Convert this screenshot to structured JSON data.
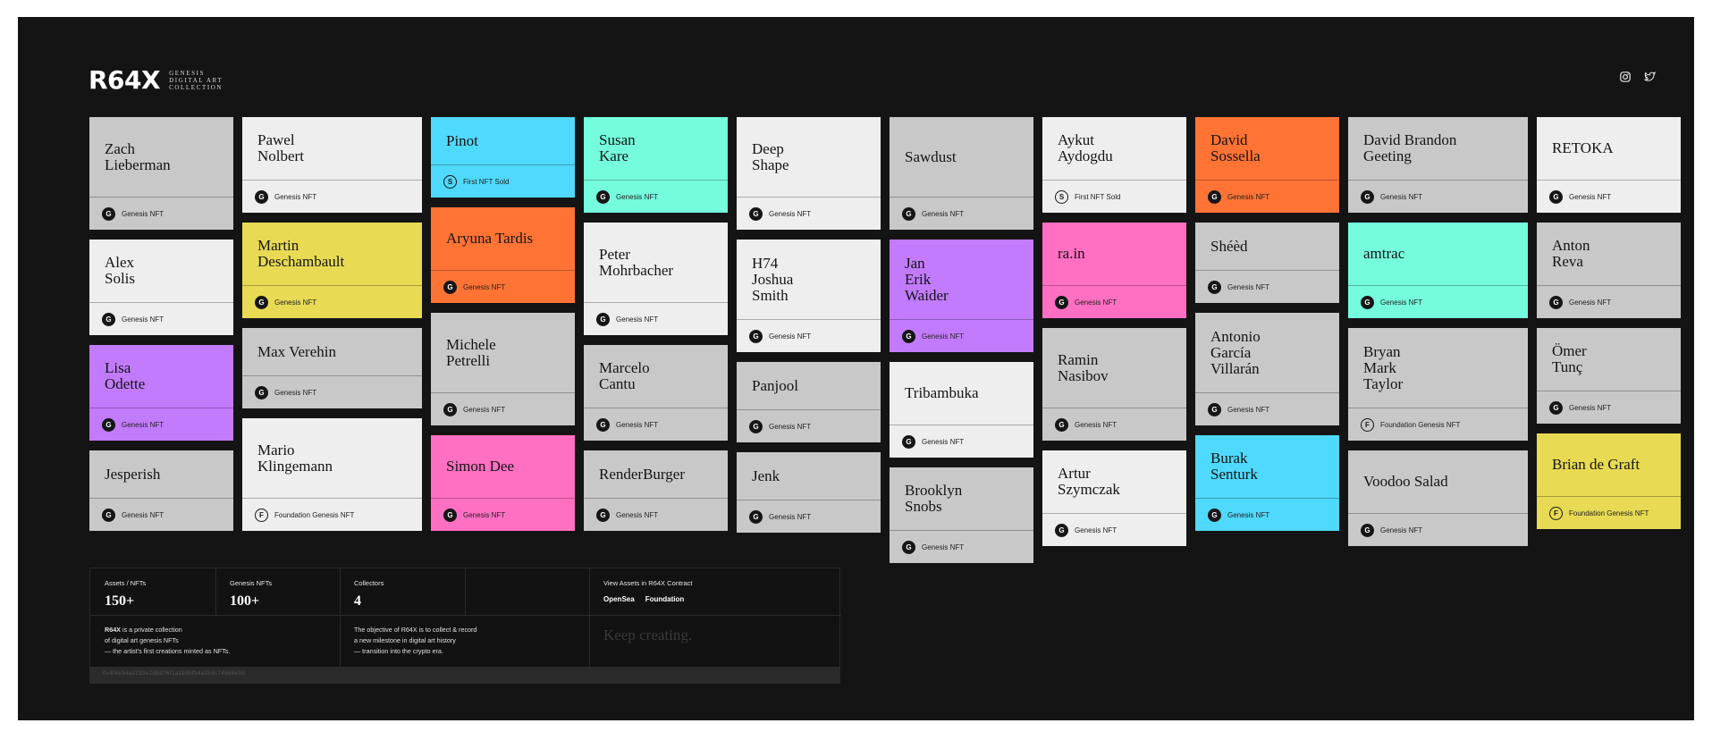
{
  "brand": {
    "mark": "R64X",
    "subtitle": [
      "GENESIS",
      "DIGITAL ART",
      "COLLECTION"
    ]
  },
  "social": {
    "icons": [
      "instagram-icon",
      "twitter-icon"
    ]
  },
  "colors": {
    "bg": "#141414",
    "light": "#eeeeee",
    "gray": "#c8c8c8",
    "cyan": "#4fd9fc",
    "mint": "#74fcdd",
    "orange": "#ff7335",
    "yellow": "#e8da53",
    "purple": "#c27bfc",
    "pink": "#ff6fc2"
  },
  "columns": [
    {
      "cards": [
        {
          "name": "Zach\nLieberman",
          "tag": "Genesis NFT",
          "badge": "G",
          "color": "gray"
        },
        {
          "name": "Alex\nSolis",
          "tag": "Genesis NFT",
          "badge": "G",
          "color": "light"
        },
        {
          "name": "Lisa\nOdette",
          "tag": "Genesis NFT",
          "badge": "G",
          "color": "purple"
        },
        {
          "name": "Jesperish",
          "tag": "Genesis NFT",
          "badge": "G",
          "color": "gray"
        }
      ]
    },
    {
      "cards": [
        {
          "name": "Pawel\nNolbert",
          "tag": "Genesis NFT",
          "badge": "G",
          "color": "light"
        },
        {
          "name": "Martin\nDeschambault",
          "tag": "Genesis NFT",
          "badge": "G",
          "color": "yellow"
        },
        {
          "name": "Max Verehin",
          "tag": "Genesis NFT",
          "badge": "G",
          "color": "gray"
        },
        {
          "name": "Mario\nKlingemann",
          "tag": "Foundation Genesis NFT",
          "badge": "F",
          "color": "light"
        }
      ]
    },
    {
      "cards": [
        {
          "name": "Pinot",
          "tag": "First NFT Sold",
          "badge": "S",
          "color": "cyan"
        },
        {
          "name": "Aryuna Tardis",
          "tag": "Genesis NFT",
          "badge": "G",
          "color": "orange"
        },
        {
          "name": "Michele\nPetrelli",
          "tag": "Genesis NFT",
          "badge": "G",
          "color": "gray"
        },
        {
          "name": "Simon Dee",
          "tag": "Genesis NFT",
          "badge": "G",
          "color": "pink"
        }
      ]
    },
    {
      "cards": [
        {
          "name": "Susan\nKare",
          "tag": "Genesis NFT",
          "badge": "G",
          "color": "mint"
        },
        {
          "name": "Peter\nMohrbacher",
          "tag": "Genesis NFT",
          "badge": "G",
          "color": "light"
        },
        {
          "name": "Marcelo\nCantu",
          "tag": "Genesis NFT",
          "badge": "G",
          "color": "gray"
        },
        {
          "name": "RenderBurger",
          "tag": "Genesis NFT",
          "badge": "G",
          "color": "gray"
        }
      ]
    },
    {
      "cards": [
        {
          "name": "Deep\nShape",
          "tag": "Genesis NFT",
          "badge": "G",
          "color": "light"
        },
        {
          "name": "H74\nJoshua\nSmith",
          "tag": "Genesis NFT",
          "badge": "G",
          "color": "light"
        },
        {
          "name": "Panjool",
          "tag": "Genesis NFT",
          "badge": "G",
          "color": "gray"
        },
        {
          "name": "Jenk",
          "tag": "Genesis NFT",
          "badge": "G",
          "color": "gray"
        }
      ]
    },
    {
      "cards": [
        {
          "name": "Sawdust",
          "tag": "Genesis NFT",
          "badge": "G",
          "color": "gray"
        },
        {
          "name": "Jan\nErik\nWaider",
          "tag": "Genesis NFT",
          "badge": "G",
          "color": "purple"
        },
        {
          "name": "Tribambuka",
          "tag": "Genesis NFT",
          "badge": "G",
          "color": "light"
        },
        {
          "name": "Brooklyn\nSnobs",
          "tag": "Genesis NFT",
          "badge": "G",
          "color": "gray"
        }
      ]
    },
    {
      "cards": [
        {
          "name": "Aykut\nAydogdu",
          "tag": "First NFT Sold",
          "badge": "S",
          "color": "light"
        },
        {
          "name": "ra.in",
          "tag": "Genesis NFT",
          "badge": "G",
          "color": "pink"
        },
        {
          "name": "Ramin\nNasibov",
          "tag": "Genesis NFT",
          "badge": "G",
          "color": "gray"
        },
        {
          "name": "Artur\nSzymczak",
          "tag": "Genesis NFT",
          "badge": "G",
          "color": "light"
        }
      ]
    },
    {
      "cards": [
        {
          "name": "David\nSossella",
          "tag": "Genesis NFT",
          "badge": "G",
          "color": "orange"
        },
        {
          "name": "Shéèd",
          "tag": "Genesis NFT",
          "badge": "G",
          "color": "gray"
        },
        {
          "name": "Antonio\nGarcía\nVillarán",
          "tag": "Genesis NFT",
          "badge": "G",
          "color": "gray"
        },
        {
          "name": "Burak\nSenturk",
          "tag": "Genesis NFT",
          "badge": "G",
          "color": "cyan"
        }
      ]
    },
    {
      "cards": [
        {
          "name": "David Brandon\nGeeting",
          "tag": "Genesis NFT",
          "badge": "G",
          "color": "gray"
        },
        {
          "name": "amtrac",
          "tag": "Genesis NFT",
          "badge": "G",
          "color": "mint"
        },
        {
          "name": "Bryan\nMark\nTaylor",
          "tag": "Foundation Genesis NFT",
          "badge": "F",
          "color": "gray"
        },
        {
          "name": "Voodoo Salad",
          "tag": "Genesis NFT",
          "badge": "G",
          "color": "gray"
        }
      ]
    },
    {
      "cards": [
        {
          "name": "RETOKA",
          "tag": "Genesis NFT",
          "badge": "G",
          "color": "light"
        },
        {
          "name": "Anton\nReva",
          "tag": "Genesis NFT",
          "badge": "G",
          "color": "gray"
        },
        {
          "name": "Ömer\nTunç",
          "tag": "Genesis NFT",
          "badge": "G",
          "color": "gray"
        },
        {
          "name": "Brian de Graft",
          "tag": "Foundation Genesis NFT",
          "badge": "F",
          "color": "yellow"
        }
      ]
    }
  ],
  "stats": {
    "assets": {
      "label": "Assets / NFTs",
      "value": "150+"
    },
    "genesis": {
      "label": "Genesis NFTs",
      "value": "100+"
    },
    "collectors": {
      "label": "Collectors",
      "value": "4"
    },
    "contract": {
      "label": "View Assets in R64X Contract",
      "links": [
        "OpenSea",
        "Foundation"
      ]
    },
    "about_brand": "R64X",
    "about_rest_1": " is a private collection",
    "about_lines": [
      "of digital art genesis NFTs",
      "— the artist's first creations minted as NFTs."
    ],
    "objective_lines": [
      "The objective of R64X is to collect & record",
      "a new milestone in digital art history",
      "— transition into the crypto era."
    ],
    "keep": "Keep creating.",
    "address": "0x4f4e34a2233e2d8d76f1a1b8bfb4a2b8c74b66e0d"
  }
}
